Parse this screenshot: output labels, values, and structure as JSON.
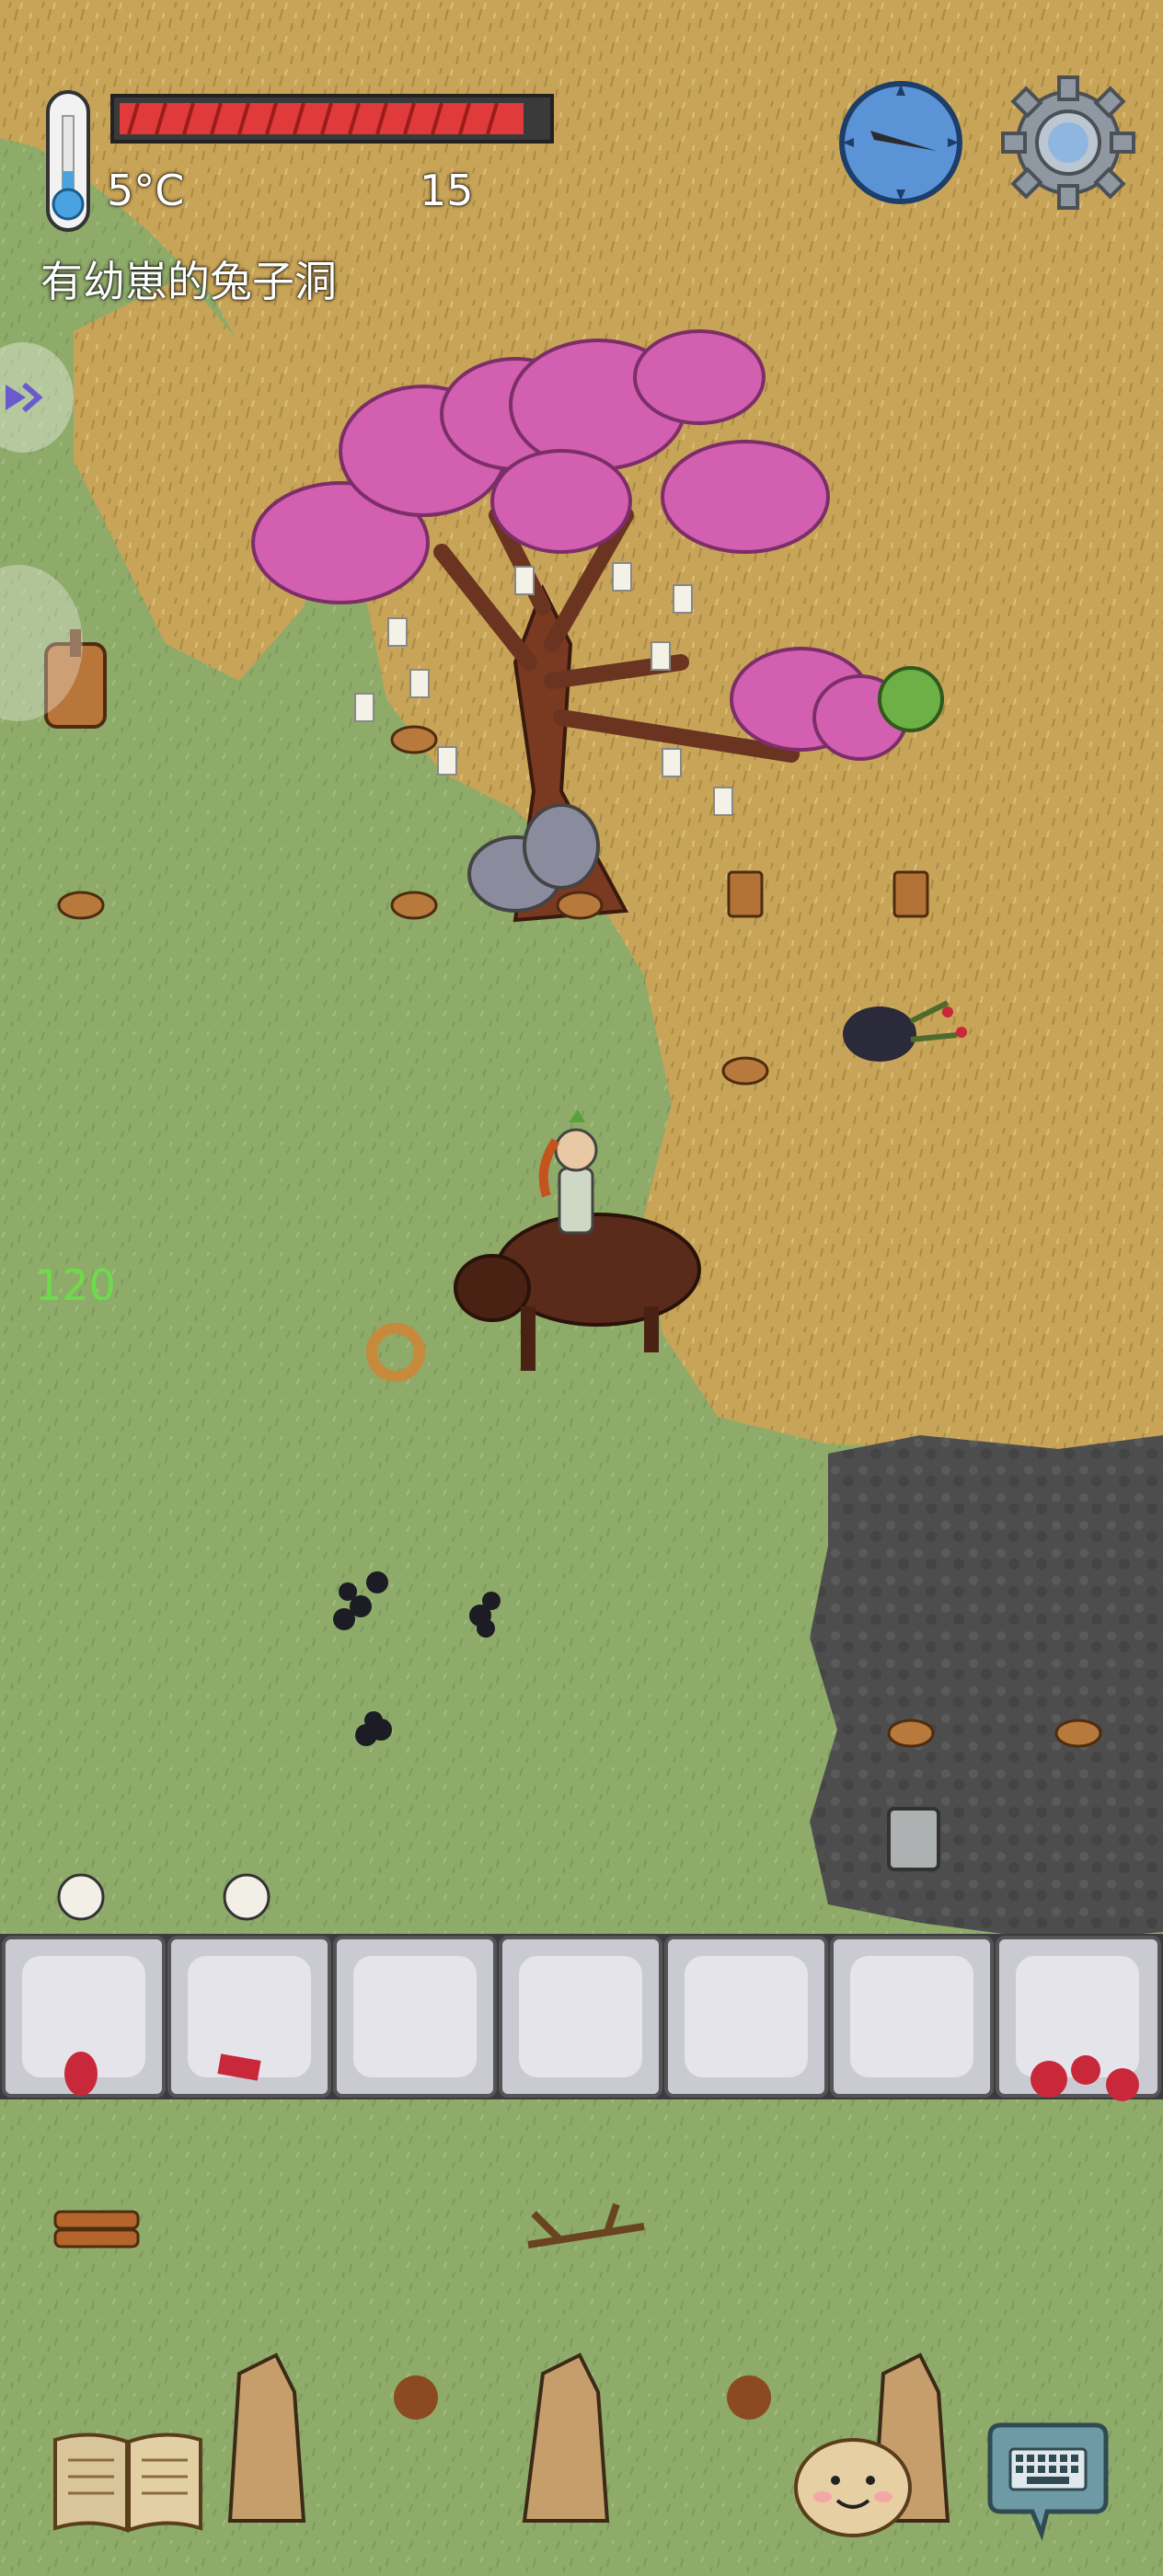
{
  "hud": {
    "temperature": "5°C",
    "food_value": "15",
    "location_label": "有幼崽的兔子洞",
    "floating_number": "120",
    "health_fraction": 0.95
  },
  "icons": {
    "thermometer": "thermometer-icon",
    "compass": "compass-icon",
    "settings": "gear-icon",
    "journal": "book-icon",
    "chat": "keyboard-chat-icon",
    "emote": "potato-face-icon",
    "side_tab": "chevron-right-icon"
  },
  "colors": {
    "grass": "#8aa866",
    "dry_grass": "#c9a45a",
    "stone_tile": "#c4c4cc",
    "ash": "#4a4a4a",
    "health": "#e03a3a",
    "floating_number": "#6ddc4a"
  }
}
